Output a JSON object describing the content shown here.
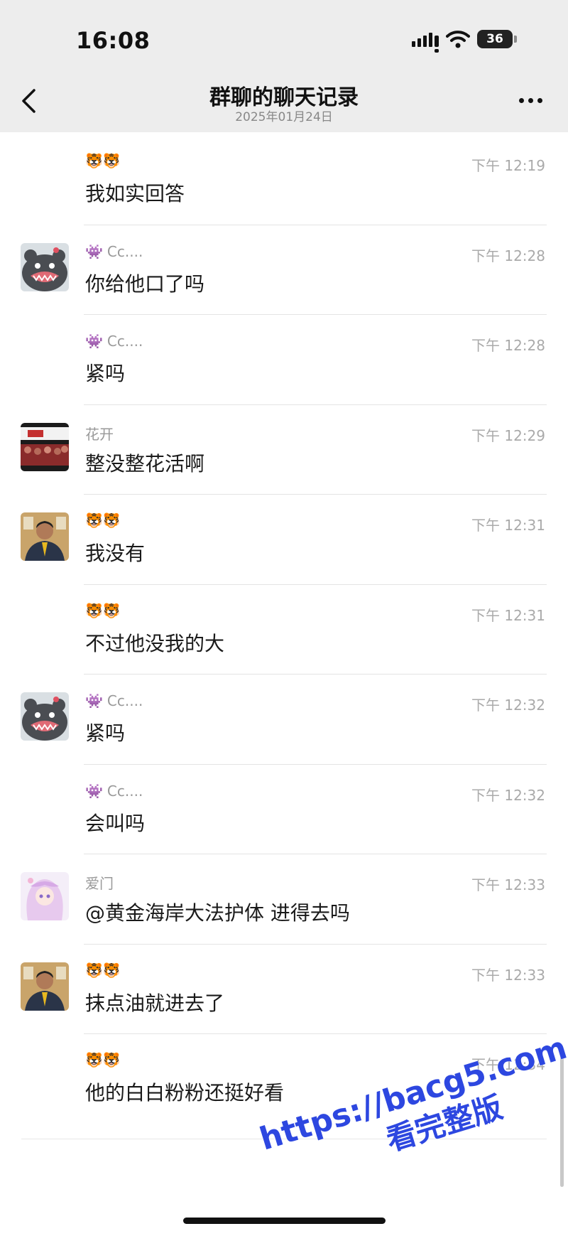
{
  "status_bar": {
    "time": "16:08",
    "battery": "36"
  },
  "nav": {
    "title": "群聊的聊天记录",
    "subtitle": "2025年01月24日"
  },
  "messages": [
    {
      "sender": "",
      "emoji": "🐯🐯",
      "time": "下午 12:19",
      "text": "我如实回答",
      "avatar": "none"
    },
    {
      "sender": "Cc....",
      "emoji": "👾",
      "time": "下午 12:28",
      "text": "你给他口了吗",
      "avatar": "gray-monster-avatar"
    },
    {
      "sender": "Cc....",
      "emoji": "👾",
      "time": "下午 12:28",
      "text": "紧吗",
      "avatar": "none"
    },
    {
      "sender": "花开",
      "emoji": "",
      "time": "下午 12:29",
      "text": "整没整花活啊",
      "avatar": "crowd-photo-avatar"
    },
    {
      "sender": "",
      "emoji": "🐯🐯",
      "time": "下午 12:31",
      "text": "我没有",
      "avatar": "man-in-suit-avatar"
    },
    {
      "sender": "",
      "emoji": "🐯🐯",
      "time": "下午 12:31",
      "text": "不过他没我的大",
      "avatar": "none"
    },
    {
      "sender": "Cc....",
      "emoji": "👾",
      "time": "下午 12:32",
      "text": "紧吗",
      "avatar": "gray-monster-avatar"
    },
    {
      "sender": "Cc....",
      "emoji": "👾",
      "time": "下午 12:32",
      "text": "会叫吗",
      "avatar": "none"
    },
    {
      "sender": "爱门",
      "emoji": "",
      "time": "下午 12:33",
      "text": "@黄金海岸大法护体 进得去吗",
      "avatar": "anime-girl-avatar"
    },
    {
      "sender": "",
      "emoji": "🐯🐯",
      "time": "下午 12:33",
      "text": "抹点油就进去了",
      "avatar": "man-in-suit-avatar"
    },
    {
      "sender": "",
      "emoji": "🐯🐯",
      "time": "下午 12:34",
      "text": "他的白白粉粉还挺好看",
      "avatar": "none"
    }
  ],
  "watermark": {
    "url": "https://bacg5.com",
    "text": "看完整版"
  }
}
